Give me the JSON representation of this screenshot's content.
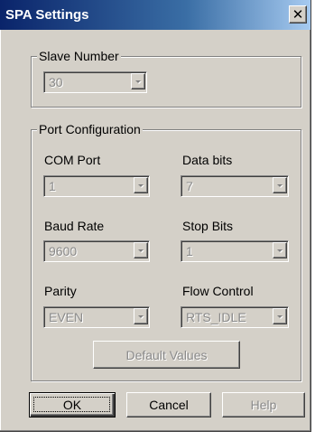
{
  "window": {
    "title": "SPA Settings",
    "close_glyph": "✕"
  },
  "slave_group": {
    "legend": "Slave Number",
    "slave_number": {
      "value": "30",
      "enabled": false
    }
  },
  "port_group": {
    "legend": "Port Configuration",
    "com_port": {
      "label": "COM Port",
      "value": "1",
      "enabled": false
    },
    "data_bits": {
      "label": "Data bits",
      "value": "7",
      "enabled": false
    },
    "baud_rate": {
      "label": "Baud Rate",
      "value": "9600",
      "enabled": false
    },
    "stop_bits": {
      "label": "Stop Bits",
      "value": "1",
      "enabled": false
    },
    "parity": {
      "label": "Parity",
      "value": "EVEN",
      "enabled": false
    },
    "flow_control": {
      "label": "Flow Control",
      "value": "RTS_IDLE",
      "enabled": false
    },
    "default_values_label": "Default Values"
  },
  "buttons": {
    "ok": "OK",
    "cancel": "Cancel",
    "help": "Help"
  },
  "colors": {
    "face": "#d4d0c8",
    "title_start": "#0a246a",
    "disabled_text": "#8a8a8a"
  },
  "icons": {
    "close": "close-icon",
    "dropdown": "chevron-down-icon"
  }
}
